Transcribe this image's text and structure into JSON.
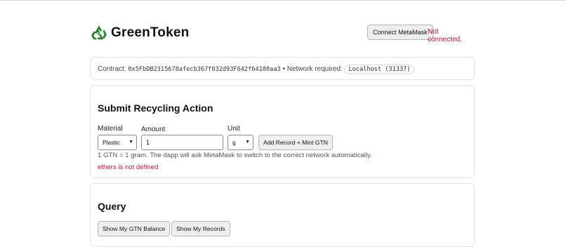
{
  "header": {
    "brand": "GreenToken",
    "logo_icon": "recycle-icon",
    "connect_button": "Connect MetaMask",
    "connection_status": "Not connected."
  },
  "contract": {
    "label": "Contract:",
    "address": "0x5FbDB2315678afecb367f032d93F642f64180aa3",
    "separator": "•",
    "network_label": "Network required:",
    "network": "Localhost (31337)"
  },
  "submit": {
    "title": "Submit Recycling Action",
    "material_label": "Material",
    "material_value": "Plastic",
    "amount_label": "Amount",
    "amount_value": "1",
    "unit_label": "Unit",
    "unit_value": "g",
    "add_button": "Add Record + Mint GTN",
    "hint": "1 GTN = 1 gram. The dapp will ask MetaMask to switch to the correct network automatically.",
    "error": "ethers is not defined"
  },
  "query": {
    "title": "Query",
    "balance_button": "Show My GTN Balance",
    "records_button": "Show My Records"
  },
  "colors": {
    "error": "#b0123a",
    "logo_green": "#2e7d32"
  }
}
